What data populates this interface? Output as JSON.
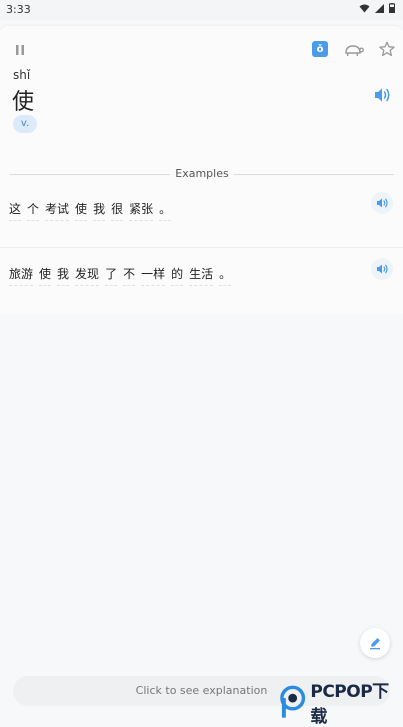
{
  "status": {
    "time": "3:33"
  },
  "word": {
    "pinyin": "shǐ",
    "hanzi": "使",
    "pos": "v."
  },
  "toolbar": {
    "tone_label": "ǒ",
    "icons": [
      "pause-icon",
      "tone-icon",
      "turtle-icon",
      "star-icon"
    ]
  },
  "examples_label": "Examples",
  "examples": [
    {
      "words": [
        "这",
        "个",
        "考试",
        "使",
        "我",
        "很",
        "紧张",
        "。"
      ]
    },
    {
      "words": [
        "旅游",
        "使",
        "我",
        "发现",
        "了",
        "不",
        "一样",
        "的",
        "生活",
        "。"
      ]
    }
  ],
  "bottom": {
    "explanation_label": "Click to see explanation"
  },
  "watermark": {
    "text": "PCPOP下载"
  },
  "colors": {
    "accent": "#4a9be8",
    "badge_bg": "#dceafa",
    "background": "#f7f8f9"
  }
}
